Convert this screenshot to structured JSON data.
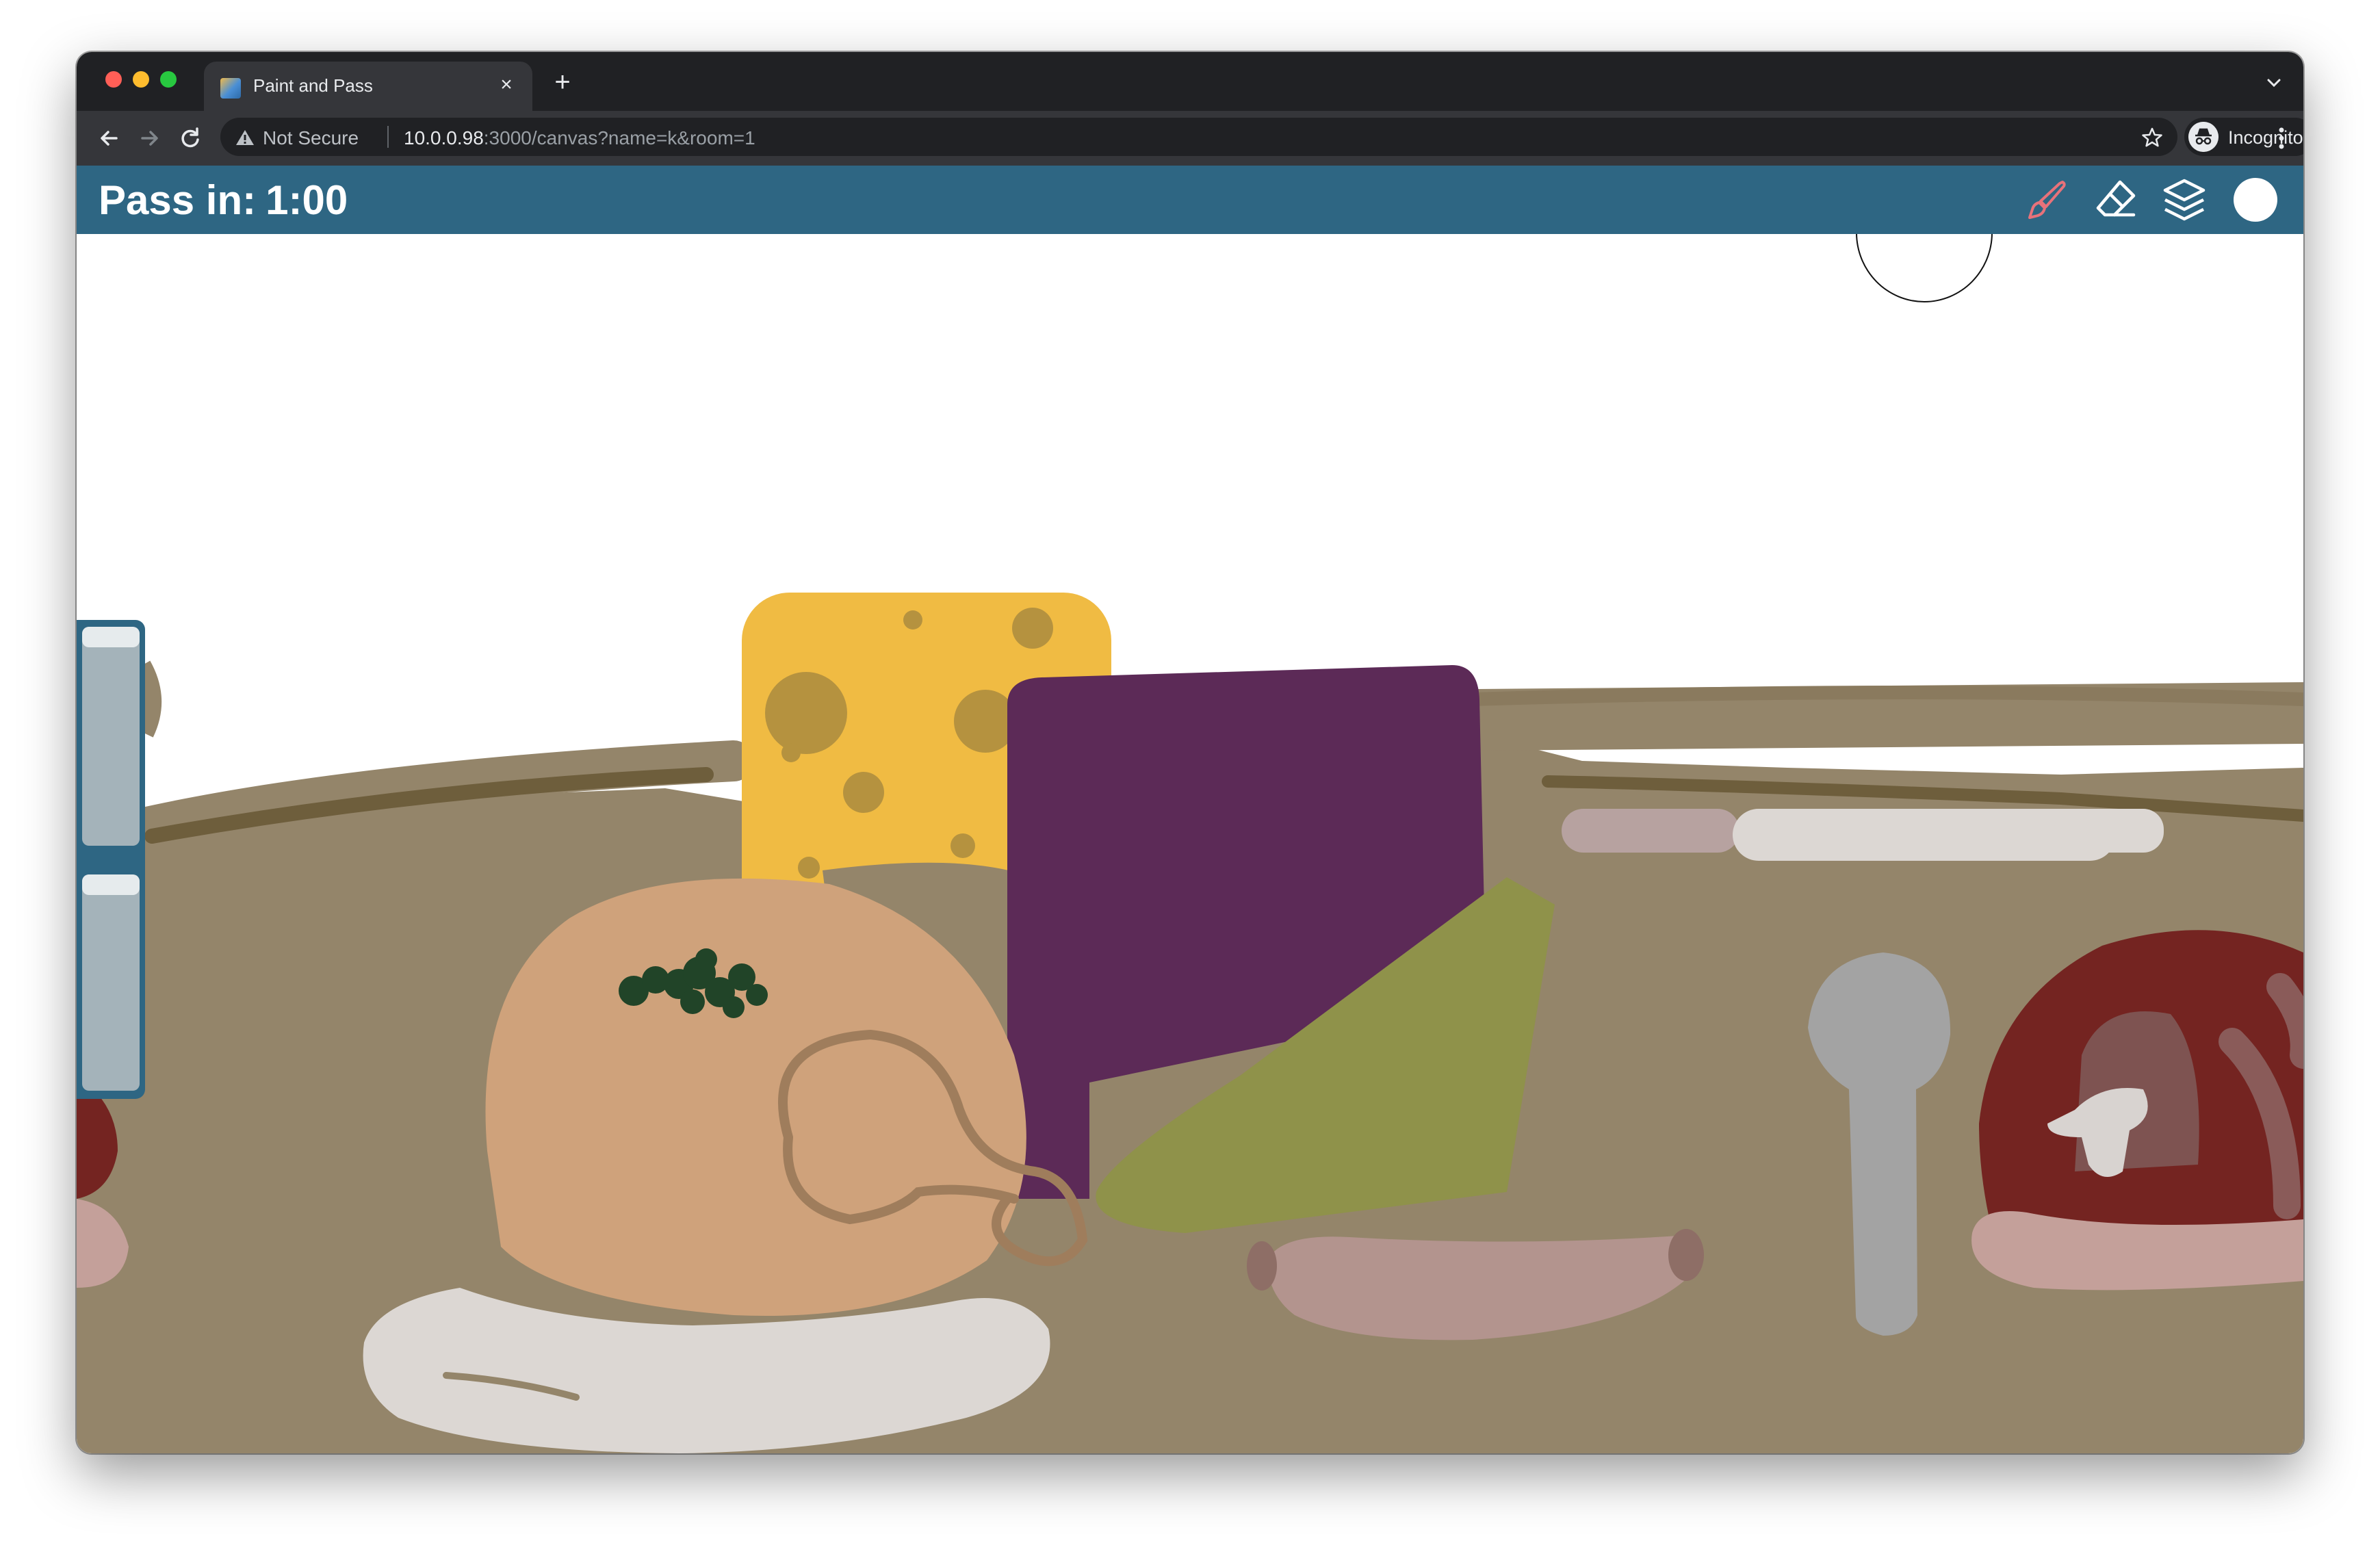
{
  "browser": {
    "tab": {
      "title": "Paint and Pass"
    },
    "address_bar": {
      "security_label": "Not Secure",
      "url_host": "10.0.0.98",
      "url_rest": ":3000/canvas?name=k&room=1"
    },
    "profile": {
      "label": "Incognito"
    }
  },
  "app": {
    "timer": {
      "label": "Pass in:",
      "value": "1:00"
    },
    "tools": [
      "brush-icon",
      "eraser-icon",
      "layers-icon",
      "color-swatch"
    ],
    "brush_color": "#ffffff",
    "accent_color": "#2e6683",
    "active_tool_color": "#e8727a"
  }
}
